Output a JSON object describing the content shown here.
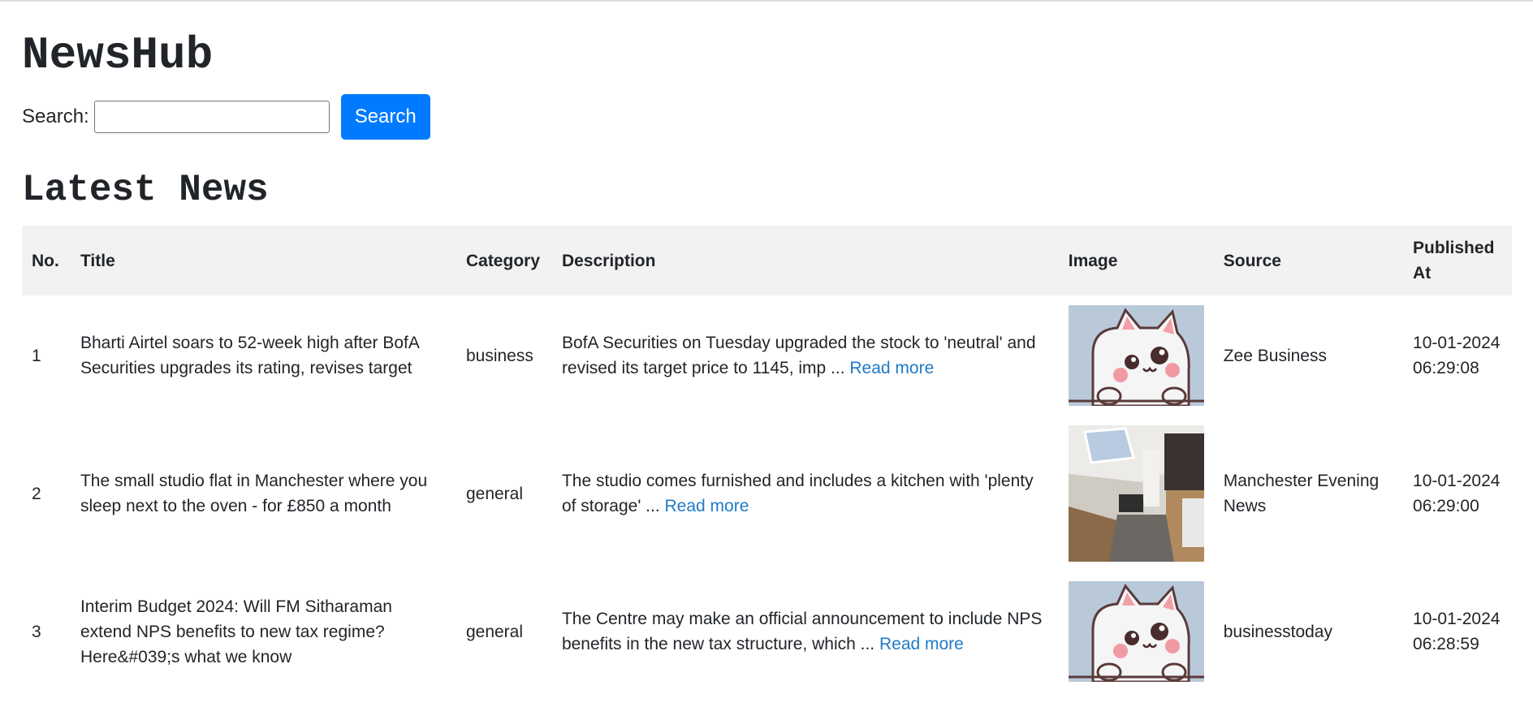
{
  "header": {
    "brand": "NewsHub"
  },
  "search": {
    "label": "Search:",
    "value": "",
    "placeholder": "",
    "button_label": "Search"
  },
  "section_title": "Latest News",
  "table": {
    "columns": [
      "No.",
      "Title",
      "Category",
      "Description",
      "Image",
      "Source",
      "Published At"
    ],
    "rows": [
      {
        "no": "1",
        "title": "Bharti Airtel soars to 52-week high after BofA Securities upgrades its rating, revises target",
        "category": "business",
        "description": "BofA Securities on Tuesday upgraded the stock to 'neutral' and revised its target price to 1145, imp ... ",
        "read_more": "Read more",
        "image": "cat-placeholder-image",
        "source": "Zee Business",
        "published": "10-01-2024 06:29:08"
      },
      {
        "no": "2",
        "title": "The small studio flat in Manchester where you sleep next to the oven - for £850 a month",
        "category": "general",
        "description": "The studio comes furnished and includes a kitchen with 'plenty of storage' ... ",
        "read_more": "Read more",
        "image": "studio-flat-photo",
        "source": "Manchester Evening News",
        "published": "10-01-2024 06:29:00"
      },
      {
        "no": "3",
        "title": "Interim Budget 2024: Will FM Sitharaman extend NPS benefits to new tax regime? Here&#039;s what we know",
        "category": "general",
        "description": "The Centre may make an official announcement to include NPS benefits in the new tax structure, which ... ",
        "read_more": "Read more",
        "image": "cat-placeholder-image",
        "source": "businesstoday",
        "published": "10-01-2024 06:28:59"
      }
    ]
  },
  "colors": {
    "accent": "#007bff",
    "link": "#1f7ac7",
    "header_bg": "#f2f2f2",
    "thumb_bg": "#b9c9d9"
  }
}
